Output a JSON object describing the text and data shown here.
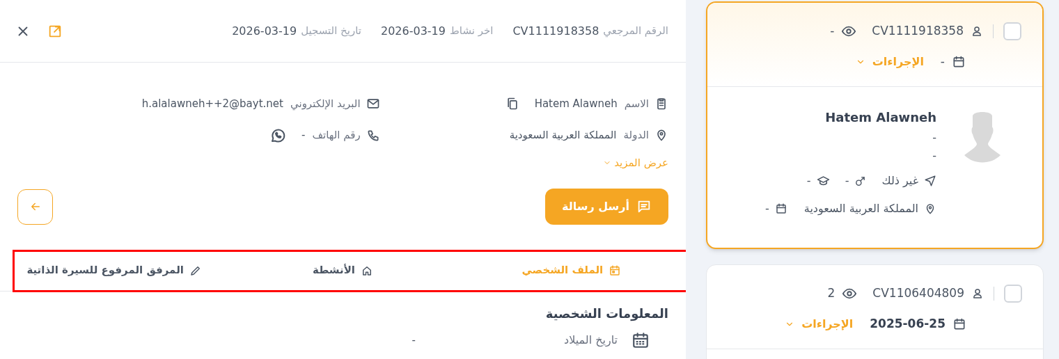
{
  "header": {
    "fields": [
      {
        "label": "الرقم المرجعي",
        "value": "CV1111918358"
      },
      {
        "label": "اخر نشاط",
        "value": "2026-03-19"
      },
      {
        "label": "تاريخ التسجيل",
        "value": "2026-03-19"
      }
    ]
  },
  "contact": {
    "name": {
      "label": "الاسم",
      "value": "Hatem Alawneh"
    },
    "email": {
      "label": "البريد الإلكتروني",
      "value": "h.alalawneh++2@bayt.net"
    },
    "country": {
      "label": "الدولة",
      "value": "المملكة العربية السعودية"
    },
    "phone": {
      "label": "رقم الهاتف",
      "value": "-"
    }
  },
  "show_more": "عرض المزيد",
  "send_message": "أرسل رسالة",
  "tabs_highlighted": true,
  "tabs": [
    {
      "kind": "profile",
      "label": "الملف الشخصي",
      "selected": true
    },
    {
      "kind": "activities",
      "label": "الأنشطة",
      "selected": false
    },
    {
      "kind": "attachment",
      "label": "المرفق المرفوع للسيرة الذاتية",
      "selected": false
    }
  ],
  "section_title": "المعلومات الشخصية",
  "personal_fields": [
    {
      "kind": "birthdate",
      "label": "تاريخ الميلاد",
      "value": "-"
    }
  ],
  "candidates": [
    {
      "selected": true,
      "checked": false,
      "cv_id": "CV1111918358",
      "views": "-",
      "date": "-",
      "actions": "الإجراءات",
      "name": "Hatem Alawneh",
      "lines": [
        "-",
        "-"
      ],
      "status": "غير ذلك",
      "gender": "-",
      "education": "-",
      "location": "المملكة العربية السعودية",
      "location_date": "-"
    },
    {
      "selected": false,
      "checked": false,
      "cv_id": "CV1106404809",
      "views": "2",
      "date": "2025-06-25",
      "actions": "الإجراءات"
    }
  ]
}
